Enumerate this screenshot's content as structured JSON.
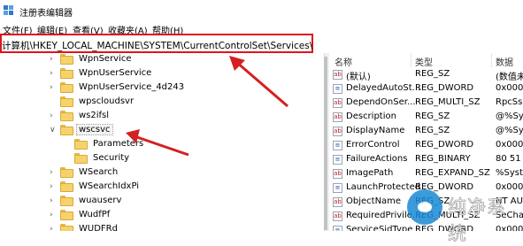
{
  "window": {
    "title": "注册表编辑器"
  },
  "menu": [
    "文件(F)",
    "编辑(E)",
    "查看(V)",
    "收藏夹(A)",
    "帮助(H)"
  ],
  "address": {
    "path": "计算机\\HKEY_LOCAL_MACHINE\\SYSTEM\\CurrentControlSet\\Services\\wscsvc"
  },
  "tree": {
    "items": [
      {
        "label": "WpnService",
        "indent": 1,
        "expandable": true
      },
      {
        "label": "WpnUserService",
        "indent": 1,
        "expandable": true
      },
      {
        "label": "WpnUserService_4d243",
        "indent": 1,
        "expandable": true
      },
      {
        "label": "wpscloudsvr",
        "indent": 1,
        "expandable": false
      },
      {
        "label": "ws2ifsl",
        "indent": 1,
        "expandable": true
      },
      {
        "label": "wscsvc",
        "indent": 1,
        "expandable": true,
        "expanded": true,
        "selected": true
      },
      {
        "label": "Parameters",
        "indent": 2,
        "expandable": false
      },
      {
        "label": "Security",
        "indent": 2,
        "expandable": false
      },
      {
        "label": "WSearch",
        "indent": 1,
        "expandable": true
      },
      {
        "label": "WSearchIdxPi",
        "indent": 1,
        "expandable": true
      },
      {
        "label": "wuauserv",
        "indent": 1,
        "expandable": true
      },
      {
        "label": "WudfPf",
        "indent": 1,
        "expandable": true
      },
      {
        "label": "WUDFRd",
        "indent": 1,
        "expandable": true
      }
    ]
  },
  "values": {
    "headers": {
      "name": "名称",
      "type": "类型",
      "data": "数据"
    },
    "rows": [
      {
        "name": "(默认)",
        "type": "REG_SZ",
        "data": "(数值未",
        "kind": "ab"
      },
      {
        "name": "DelayedAutoSt...",
        "type": "REG_DWORD",
        "data": "0x000",
        "kind": "bin"
      },
      {
        "name": "DependOnSer...",
        "type": "REG_MULTI_SZ",
        "data": "RpcSs",
        "kind": "ab"
      },
      {
        "name": "Description",
        "type": "REG_SZ",
        "data": "@%Sys",
        "kind": "ab"
      },
      {
        "name": "DisplayName",
        "type": "REG_SZ",
        "data": "@%Sys",
        "kind": "ab"
      },
      {
        "name": "ErrorControl",
        "type": "REG_DWORD",
        "data": "0x000",
        "kind": "bin"
      },
      {
        "name": "FailureActions",
        "type": "REG_BINARY",
        "data": "80 51 0",
        "kind": "bin"
      },
      {
        "name": "ImagePath",
        "type": "REG_EXPAND_SZ",
        "data": "%Syste",
        "kind": "ab"
      },
      {
        "name": "LaunchProtected",
        "type": "REG_DWORD",
        "data": "0x000",
        "kind": "bin"
      },
      {
        "name": "ObjectName",
        "type": "REG_SZ",
        "data": "NT AUT",
        "kind": "ab"
      },
      {
        "name": "RequiredPrivile...",
        "type": "REG_MULTI_SZ",
        "data": "SeCha",
        "kind": "ab"
      },
      {
        "name": "ServiceSidType",
        "type": "REG_DWORD",
        "data": "0x000",
        "kind": "bin"
      }
    ]
  },
  "watermark": {
    "text": "纯净系统"
  },
  "colors": {
    "highlight_box": "#e0141e",
    "arrow": "#d42020",
    "folder": "#f6d36a"
  }
}
